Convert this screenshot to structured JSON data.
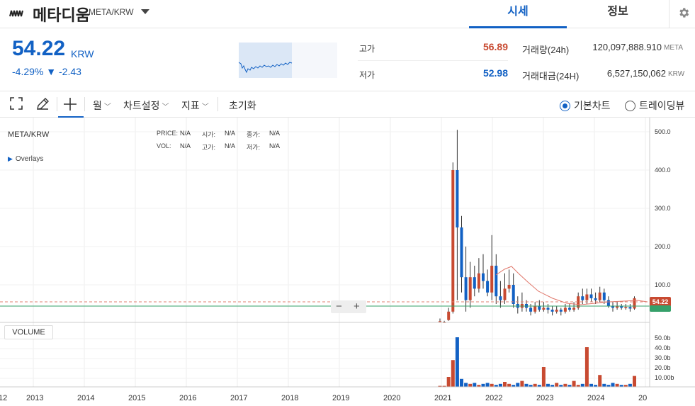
{
  "header": {
    "coin_name": "메타디움",
    "pair": "META/KRW",
    "tabs": [
      "시세",
      "정보"
    ]
  },
  "ticker": {
    "price": "54.22",
    "unit": "KRW",
    "change_rate": "-4.29%",
    "change_amount": "▼ -2.43"
  },
  "stats": {
    "high_label": "고가",
    "high_value": "56.89",
    "low_label": "저가",
    "low_value": "52.98",
    "volume_label": "거래량(24h)",
    "volume_value": "120,097,888.910",
    "volume_unit": "META",
    "amount_label": "거래대금(24H)",
    "amount_value": "6,527,150,062",
    "amount_unit": "KRW"
  },
  "toolbar": {
    "interval": "월",
    "chart_settings": "차트설정",
    "indicators": "지표",
    "reset": "초기화",
    "basic_chart": "기본차트",
    "tradingview": "트레이딩뷰"
  },
  "chart": {
    "symbol": "META/KRW",
    "overlays_label": "Overlays",
    "legend": [
      {
        "label": "PRICE:",
        "value": "N/A"
      },
      {
        "label": "시가:",
        "value": "N/A"
      },
      {
        "label": "종가:",
        "value": "N/A"
      },
      {
        "label": "VOL:",
        "value": "N/A"
      },
      {
        "label": "고가:",
        "value": "N/A"
      },
      {
        "label": "저가:",
        "value": "N/A"
      }
    ],
    "volume_label": "VOLUME",
    "zoom_minus": "−",
    "zoom_plus": "+",
    "current_price_tag": "54.22",
    "y_ticks": [
      "500.0",
      "400.0",
      "300.0",
      "200.0",
      "100.0"
    ],
    "volume_ticks": [
      "50.0b",
      "40.0b",
      "30.0b",
      "20.0b",
      "10.00b"
    ],
    "x_ticks": [
      "12",
      "2013",
      "2014",
      "2015",
      "2016",
      "2017",
      "2018",
      "2019",
      "2020",
      "2021",
      "2022",
      "2023",
      "2024",
      "20"
    ]
  },
  "colors": {
    "accent": "#1261c4",
    "up": "#c84a31",
    "down": "#1261c4",
    "ma": "#e0766a",
    "baseline": "#36a06a"
  }
}
